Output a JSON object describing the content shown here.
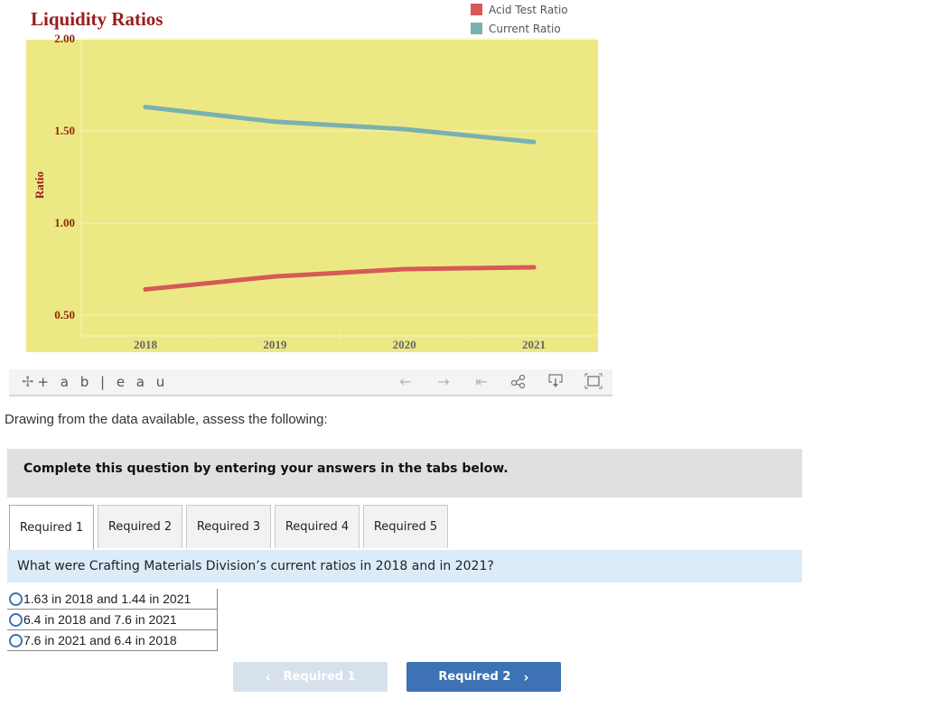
{
  "chart_data": {
    "type": "line",
    "title": "Liquidity Ratios",
    "xlabel": "",
    "ylabel": "Ratio",
    "x": [
      "2018",
      "2019",
      "2020",
      "2021"
    ],
    "ylim": [
      0.4,
      2.0
    ],
    "yticks": [
      "2.00",
      "1.50",
      "1.00",
      "0.50"
    ],
    "ytick_values": [
      2.0,
      1.5,
      1.0,
      0.5
    ],
    "grid": true,
    "legend_position": "top-right",
    "background": "#ece985",
    "series": [
      {
        "name": "Acid Test Ratio",
        "color": "#d65a56",
        "values": [
          0.64,
          0.71,
          0.75,
          0.76
        ]
      },
      {
        "name": "Current Ratio",
        "color": "#7ab0b0",
        "values": [
          1.63,
          1.55,
          1.51,
          1.44
        ]
      }
    ]
  },
  "toolbar": {
    "brand": "+ a b | e a u",
    "icons": [
      "undo-icon",
      "redo-icon",
      "revert-icon",
      "share-icon",
      "download-icon",
      "fullscreen-icon"
    ]
  },
  "prompt": "Drawing from the data available, assess the following:",
  "instructions": "Complete this question by entering your answers in the tabs below.",
  "tabs": [
    {
      "label": "Required 1",
      "active": true
    },
    {
      "label": "Required 2",
      "active": false
    },
    {
      "label": "Required 3",
      "active": false
    },
    {
      "label": "Required 4",
      "active": false
    },
    {
      "label": "Required 5",
      "active": false
    }
  ],
  "question": "What were Crafting Materials Division’s current ratios in 2018 and in 2021?",
  "options": [
    {
      "label": "1.63 in 2018 and 1.44 in 2021",
      "selected": false
    },
    {
      "label": "6.4 in 2018 and 7.6 in 2021",
      "selected": false
    },
    {
      "label": "7.6 in 2021 and 6.4 in 2018",
      "selected": false
    }
  ],
  "nav": {
    "prev_label": "Required 1",
    "next_label": "Required 2",
    "prev_chevron": "‹",
    "next_chevron": "›"
  }
}
